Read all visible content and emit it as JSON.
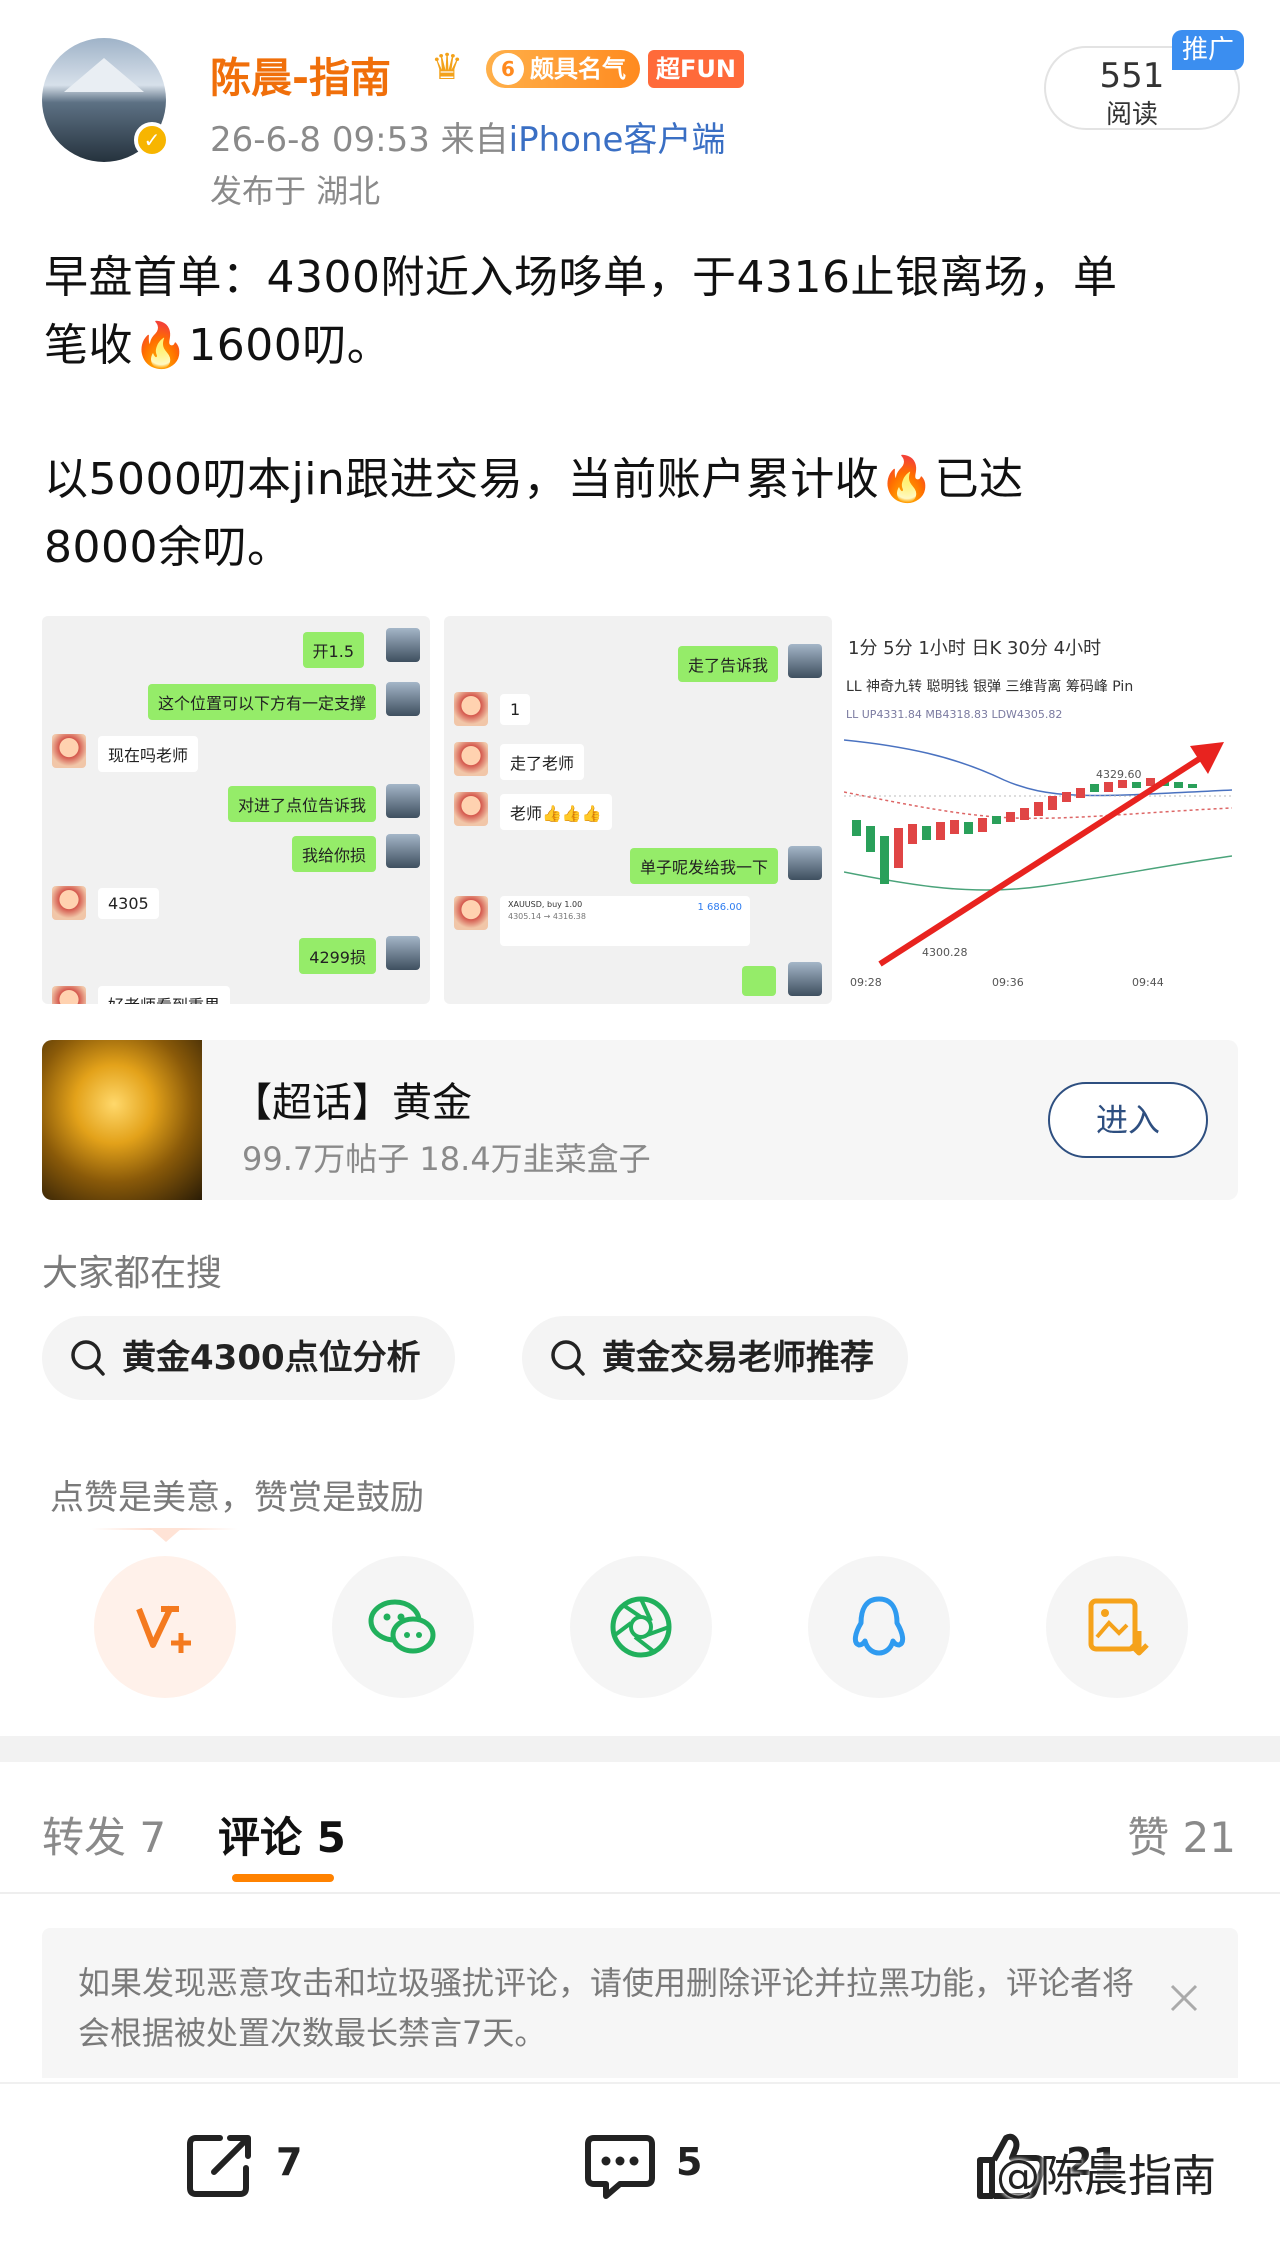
{
  "post": {
    "username": "陈晨-指南",
    "fame_level": "6",
    "fame_badge": "颇具名气",
    "fun_badge": "超FUN",
    "time": "26-6-8 09:53",
    "from_prefix": "来自",
    "source": "iPhone客户端",
    "location": "发布于 湖北",
    "reads_count": "551",
    "reads_label": "阅读",
    "promo_label": "推广",
    "para1_a": "早盘首单：4300附近入场哆单，于4316止银离场，单",
    "para1_b": "笔收",
    "para1_c": "1600叨。",
    "para2_a": "以5000叨本jin跟进交易，当前账户累计收",
    "para2_b": "已达",
    "para2_c": "8000余叨。"
  },
  "chat1": {
    "m1": "开1.5",
    "m2": "这个位置可以下方有一定支撑",
    "m3": "现在吗老师",
    "m4": "对进了点位告诉我",
    "m5": "我给你损",
    "m6": "4305",
    "m7": "4299损",
    "m8": "好老师看到重果"
  },
  "chat2": {
    "m1": "走了告诉我",
    "m2": "1",
    "m3": "走了老师",
    "m4": "老师👍👍👍",
    "m5": "单子呢发给我一下",
    "card_sym": "XAUUSD, buy 1.00",
    "card_detail": "4305.14 → 4316.38",
    "card_profit": "1 686.00"
  },
  "chart_img": {
    "tabs": "1分   5分   1小时   日K   30分   4小时",
    "tabs2": "LL  神奇九转    聪明钱  银弹   三维背离  筹码峰   Pin",
    "indicator": "LL UP4331.84  MB4318.83  LDW4305.82",
    "high_label": "4329.60",
    "low_label": "4300.28",
    "t1": "09:28",
    "t2": "09:36",
    "t3": "09:44"
  },
  "topic": {
    "title": "【超话】黄金",
    "stats": "99.7万帖子 18.4万韭菜盒子",
    "enter": "进入"
  },
  "search": {
    "header": "大家都在搜",
    "chip1": "黄金4300点位分析",
    "chip2": "黄金交易老师推荐"
  },
  "reward": {
    "header": "点赞是美意，赞赏是鼓励"
  },
  "tabs": {
    "repost": "转发 7",
    "comment": "评论 5",
    "like": "赞 21"
  },
  "notice": {
    "text": "如果发现恶意攻击和垃圾骚扰评论，请使用删除评论并拉黑功能，评论者将会根据被处置次数最长禁言7天。"
  },
  "bottom": {
    "share_count": "7",
    "comment_count": "5",
    "like_count": "21"
  },
  "watermark": "@陈晨指南",
  "colors": {
    "brand_orange": "#f06f0a",
    "link_blue": "#3a6fc4",
    "tab_underline": "#ff8200",
    "enter_border": "#2e4f80"
  }
}
